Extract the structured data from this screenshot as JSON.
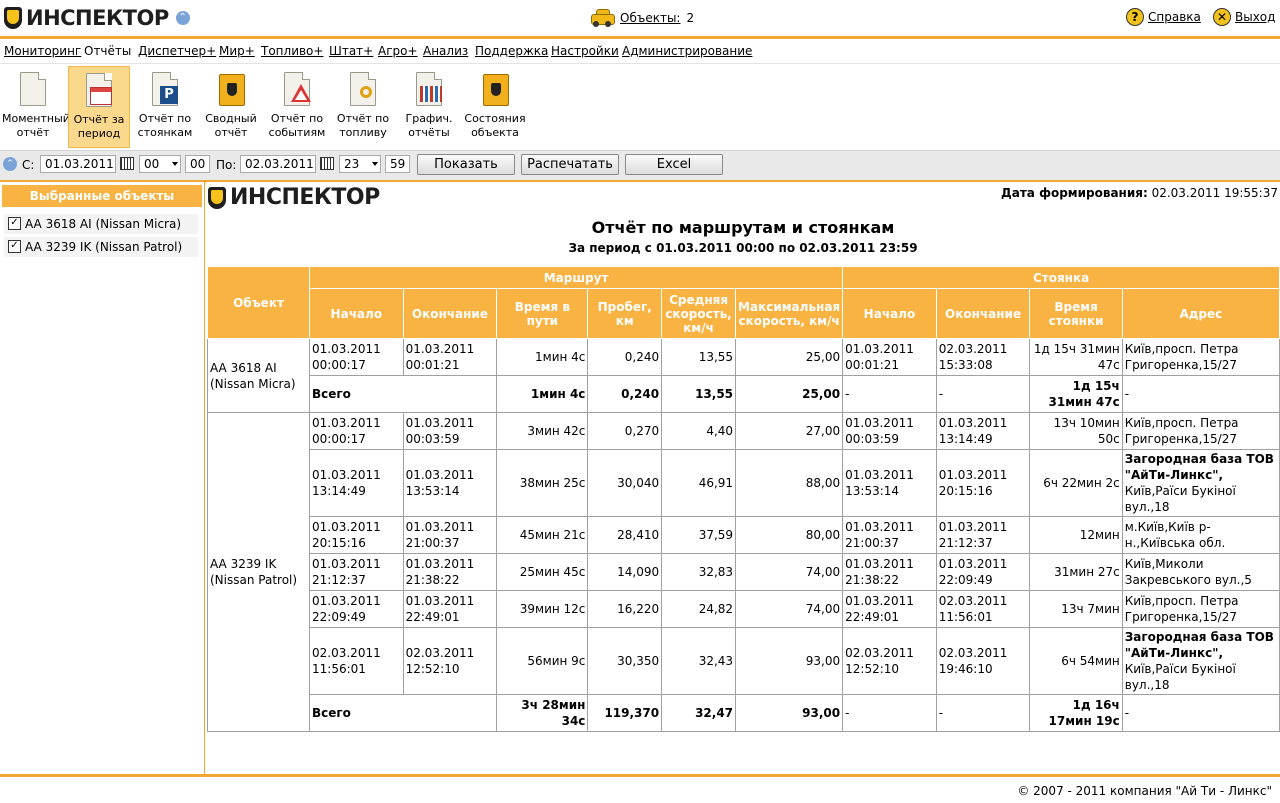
{
  "header": {
    "logo_text": "ИНСПЕКТОР",
    "objects_label": "Объекты:",
    "objects_count": "2",
    "help_label": "Справка",
    "exit_label": "Выход"
  },
  "menu": [
    "Мониторинг",
    "Отчёты",
    "Диспетчер+",
    "Мир+",
    "Топливо+",
    "Штат+",
    "Агро+",
    "Анализ",
    "Поддержка",
    "Настройки",
    "Администрирование"
  ],
  "toolbar": [
    {
      "line1": "Моментный",
      "line2": "отчёт",
      "icon": "doc-icon"
    },
    {
      "line1": "Отчёт за",
      "line2": "период",
      "icon": "calendar-report-icon"
    },
    {
      "line1": "Отчёт по",
      "line2": "стоянкам",
      "icon": "parking-report-icon"
    },
    {
      "line1": "Сводный",
      "line2": "отчёт",
      "icon": "summary-book-icon"
    },
    {
      "line1": "Отчёт по",
      "line2": "событиям",
      "icon": "warning-report-icon"
    },
    {
      "line1": "Отчёт по",
      "line2": "топливу",
      "icon": "fuel-report-icon"
    },
    {
      "line1": "Графич.",
      "line2": "отчёты",
      "icon": "chart-report-icon"
    },
    {
      "line1": "Состояния",
      "line2": "объекта",
      "icon": "object-state-icon"
    }
  ],
  "datebar": {
    "from_label": "С:",
    "from_date": "01.03.2011",
    "from_hour": "00",
    "from_min": "00",
    "to_label": "По:",
    "to_date": "02.03.2011",
    "to_hour": "23",
    "to_min": "59",
    "show_btn": "Показать",
    "print_btn": "Распечатать",
    "excel_btn": "Excel"
  },
  "left_panel": {
    "title": "Выбранные объекты",
    "items": [
      "AA 3618 AI (Nissan Micra)",
      "AA 3239 IK (Nissan Patrol)"
    ]
  },
  "report": {
    "logo_text": "ИНСПЕКТОР",
    "gen_label": "Дата формирования:",
    "gen_value": "02.03.2011 19:55:37",
    "title": "Отчёт по маршрутам и стоянкам",
    "subtitle": "За период с 01.03.2011 00:00 по 02.03.2011 23:59",
    "headers": {
      "object": "Объект",
      "route": "Маршрут",
      "parking": "Стоянка",
      "start": "Начало",
      "end": "Окончание",
      "travel_time": "Время в пути",
      "mileage": "Пробег, км",
      "avg_speed": "Средняя скорость, км/ч",
      "max_speed": "Максимальная скорость, км/ч",
      "p_start": "Начало",
      "p_end": "Окончание",
      "p_time": "Время стоянки",
      "address": "Адрес"
    },
    "groups": [
      {
        "object": "AA 3618 AI (Nissan Micra)",
        "rows": [
          {
            "start": "01.03.2011 00:00:17",
            "end": "01.03.2011 00:01:21",
            "time": "1мин 4с",
            "km": "0,240",
            "avg": "13,55",
            "max": "25,00",
            "p_start": "01.03.2011 00:01:21",
            "p_end": "02.03.2011 15:33:08",
            "p_time": "1д 15ч 31мин 47с",
            "addr": "Київ,просп. Петра Григоренка,15/27",
            "addr_bold": ""
          }
        ],
        "total": {
          "label": "Всего",
          "time": "1мин 4с",
          "km": "0,240",
          "avg": "13,55",
          "max": "25,00",
          "p_start": "-",
          "p_end": "-",
          "p_time": "1д 15ч 31мин 47с",
          "addr": "-"
        }
      },
      {
        "object": "AA 3239 IK (Nissan Patrol)",
        "rows": [
          {
            "start": "01.03.2011 00:00:17",
            "end": "01.03.2011 00:03:59",
            "time": "3мин 42с",
            "km": "0,270",
            "avg": "4,40",
            "max": "27,00",
            "p_start": "01.03.2011 00:03:59",
            "p_end": "01.03.2011 13:14:49",
            "p_time": "13ч 10мин 50с",
            "addr": "Київ,просп. Петра Григоренка,15/27",
            "addr_bold": ""
          },
          {
            "start": "01.03.2011 13:14:49",
            "end": "01.03.2011 13:53:14",
            "time": "38мин 25с",
            "km": "30,040",
            "avg": "46,91",
            "max": "88,00",
            "p_start": "01.03.2011 13:53:14",
            "p_end": "01.03.2011 20:15:16",
            "p_time": "6ч 22мин 2с",
            "addr": "Київ,Раїси Букіної вул.,18",
            "addr_bold": "Загородная база ТОВ \"АйТи-Линкс\","
          },
          {
            "start": "01.03.2011 20:15:16",
            "end": "01.03.2011 21:00:37",
            "time": "45мин 21с",
            "km": "28,410",
            "avg": "37,59",
            "max": "80,00",
            "p_start": "01.03.2011 21:00:37",
            "p_end": "01.03.2011 21:12:37",
            "p_time": "12мин",
            "addr": "м.Київ,Київ р-н.,Київська обл.",
            "addr_bold": ""
          },
          {
            "start": "01.03.2011 21:12:37",
            "end": "01.03.2011 21:38:22",
            "time": "25мин 45с",
            "km": "14,090",
            "avg": "32,83",
            "max": "74,00",
            "p_start": "01.03.2011 21:38:22",
            "p_end": "01.03.2011 22:09:49",
            "p_time": "31мин 27с",
            "addr": "Київ,Миколи Закревського вул.,5",
            "addr_bold": ""
          },
          {
            "start": "01.03.2011 22:09:49",
            "end": "01.03.2011 22:49:01",
            "time": "39мин 12с",
            "km": "16,220",
            "avg": "24,82",
            "max": "74,00",
            "p_start": "01.03.2011 22:49:01",
            "p_end": "02.03.2011 11:56:01",
            "p_time": "13ч 7мин",
            "addr": "Київ,просп. Петра Григоренка,15/27",
            "addr_bold": ""
          },
          {
            "start": "02.03.2011 11:56:01",
            "end": "02.03.2011 12:52:10",
            "time": "56мин 9с",
            "km": "30,350",
            "avg": "32,43",
            "max": "93,00",
            "p_start": "02.03.2011 12:52:10",
            "p_end": "02.03.2011 19:46:10",
            "p_time": "6ч 54мин",
            "addr": "Київ,Раїси Букіної вул.,18",
            "addr_bold": "Загородная база ТОВ \"АйТи-Линкс\","
          }
        ],
        "total": {
          "label": "Всего",
          "time": "3ч 28мин 34с",
          "km": "119,370",
          "avg": "32,47",
          "max": "93,00",
          "p_start": "-",
          "p_end": "-",
          "p_time": "1д 16ч 17мин 19с",
          "addr": "-"
        }
      }
    ]
  },
  "footer": {
    "copyright": "© 2007 - 2011 компания \"Ай Ти - Линкс\""
  },
  "colors": {
    "accent": "#f8b343",
    "border_accent": "#f0a830",
    "selected_tool": "#fbd98c"
  }
}
